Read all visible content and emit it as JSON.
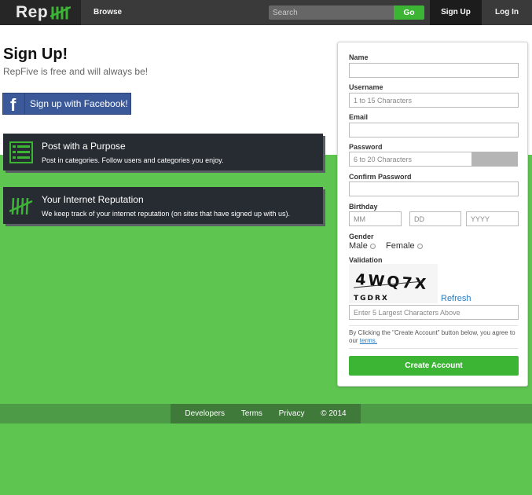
{
  "nav": {
    "logo_text": "Rep",
    "browse": "Browse",
    "search_placeholder": "Search",
    "go": "Go",
    "signup": "Sign Up",
    "login": "Log In"
  },
  "main": {
    "title": "Sign Up!",
    "subtitle": "RepFive is free and will always be!",
    "facebook": "Sign up with Facebook!",
    "features": [
      {
        "title": "Post with a Purpose",
        "desc": "Post in categories. Follow users and categories you enjoy.",
        "icon": "list-icon"
      },
      {
        "title": "Your Internet Reputation",
        "desc": "We keep track of your internet reputation (on sites that have signed up with us).",
        "icon": "tally-icon"
      }
    ]
  },
  "form": {
    "name_label": "Name",
    "username_label": "Username",
    "username_placeholder": "1 to 15 Characters",
    "email_label": "Email",
    "password_label": "Password",
    "password_placeholder": "6 to 20 Characters",
    "confirm_label": "Confirm Password",
    "birthday_label": "Birthday",
    "mm": "MM",
    "dd": "DD",
    "yyyy": "YYYY",
    "gender_label": "Gender",
    "male": "Male",
    "female": "Female",
    "validation_label": "Validation",
    "captcha_text": "4WQ7X",
    "captcha_small": "TGDRX",
    "refresh": "Refresh",
    "captcha_placeholder": "Enter 5 Largest Characters Above",
    "terms_text": "By Clicking the \"Create Account\" button below, you agree to our ",
    "terms_link": "terms.",
    "create": "Create Account"
  },
  "footer": {
    "developers": "Developers",
    "terms": "Terms",
    "privacy": "Privacy",
    "copyright": "© 2014"
  },
  "colors": {
    "accent_green": "#3cb535",
    "background_green": "#5fc551",
    "facebook_blue": "#3b5998",
    "dark_nav": "#3a3a3a"
  }
}
